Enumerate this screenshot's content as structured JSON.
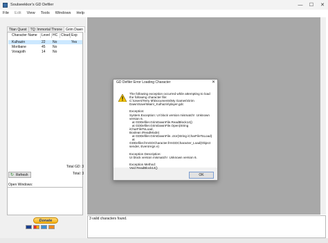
{
  "window": {
    "title": "Soulseekkor's GD Defiler",
    "controls": {
      "minimize": "—",
      "maximize": "☐",
      "close": "✕"
    }
  },
  "menu": [
    "File",
    "Edit",
    "View",
    "Tools",
    "Windows",
    "Help"
  ],
  "tabs": [
    "Titan Quest",
    "TQ: Immortal Throne",
    "Grim Dawn"
  ],
  "active_tab": "Grim Dawn",
  "table": {
    "columns": [
      "Character Name",
      "Level",
      "HC",
      "Cloud",
      "Exp"
    ],
    "rows": [
      {
        "name": "Kulhazin",
        "level": "22",
        "hc": "No",
        "cloud": "",
        "exp": "Yes"
      },
      {
        "name": "Moribane",
        "level": "45",
        "hc": "No",
        "cloud": "",
        "exp": ""
      },
      {
        "name": "Voragoth",
        "level": "14",
        "hc": "No",
        "cloud": "",
        "exp": ""
      }
    ]
  },
  "total_gd": "Total GD: 3",
  "total": "Total: 3",
  "refresh_label": "Refresh",
  "open_windows_label": "Open Windows:",
  "donate_label": "Donate",
  "log_text": "3 valid characters found.",
  "dialog": {
    "title": "GD Defiler Error Loading Character",
    "close": "✕",
    "message": "The following exception occurred while attempting to load\nthe following character file:\nC:\\Users\\Terry M\\Documents\\My Games\\Grim\nDawn\\Save\\Main\\_Kulhazin\\player.gdc\n\nException:\nSystem.Exception: UI block version mismatch!  Unknown\nversion 6.\n   at GDDefiler.GrimDawnFile.ReadBlock14()\n   at GDDefiler.GrimDawnFile.Open(String iCharFileToLoad,\nBoolean iReadMode)\n   at GDDefiler.GrimDawnFile..ctor(String iCharFileToLoad)\n   at GDDefiler.frmGDCharacter.frmGDCharacter_Load(Object\nsender, EventArgs e)\n\nException Description:\nUI block version mismatch!  Unknown version 6.\n\nException Method:\nVoid ReadBlock14()",
    "ok_label": "OK"
  }
}
